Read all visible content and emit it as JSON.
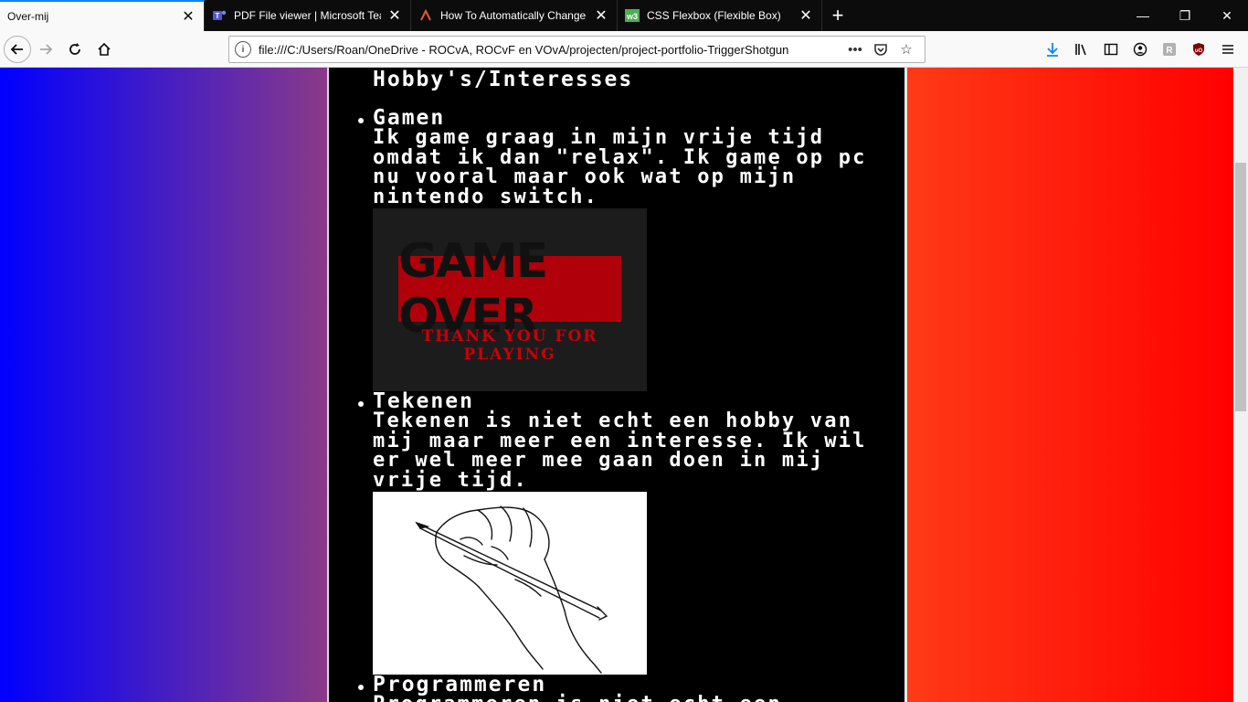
{
  "tabs": [
    {
      "title": "Over-mij",
      "active": true,
      "icon": "page-icon"
    },
    {
      "title": "PDF File viewer | Microsoft Tea",
      "active": false,
      "icon": "teams-icon"
    },
    {
      "title": "How To Automatically Change",
      "active": false,
      "icon": "web-icon"
    },
    {
      "title": "CSS Flexbox (Flexible Box)",
      "active": false,
      "icon": "w3schools-icon"
    }
  ],
  "window": {
    "minimize": "—",
    "restore": "❐",
    "close": "✕"
  },
  "nav": {
    "url": "file:///C:/Users/Roan/OneDrive - ROCvA, ROCvF en VOvA/projecten/project-portfolio-TriggerShotgun"
  },
  "page": {
    "section_title": "Hobby's/Interesses",
    "items": [
      {
        "title": "Gamen",
        "text": "Ik game graag in mijn vrije tijd omdat ik dan \"relax\". Ik game op pc nu vooral maar ook wat op mijn nintendo switch.",
        "image_text": "GAME OVER",
        "image_sub": "THANK YOU FOR PLAYING"
      },
      {
        "title": "Tekenen",
        "text": "Tekenen is niet echt een hobby van mij maar meer een interesse. Ik wil er wel meer mee gaan doen in mij vrije tijd."
      },
      {
        "title": "Programmeren",
        "text": "Programmeren is niet echt een"
      }
    ]
  },
  "colors": {
    "accent": "#0a84ff",
    "left_gradient": [
      "#0000ff",
      "#8a3a88"
    ],
    "right_gradient": [
      "#ff3a17",
      "#ff0000"
    ]
  }
}
